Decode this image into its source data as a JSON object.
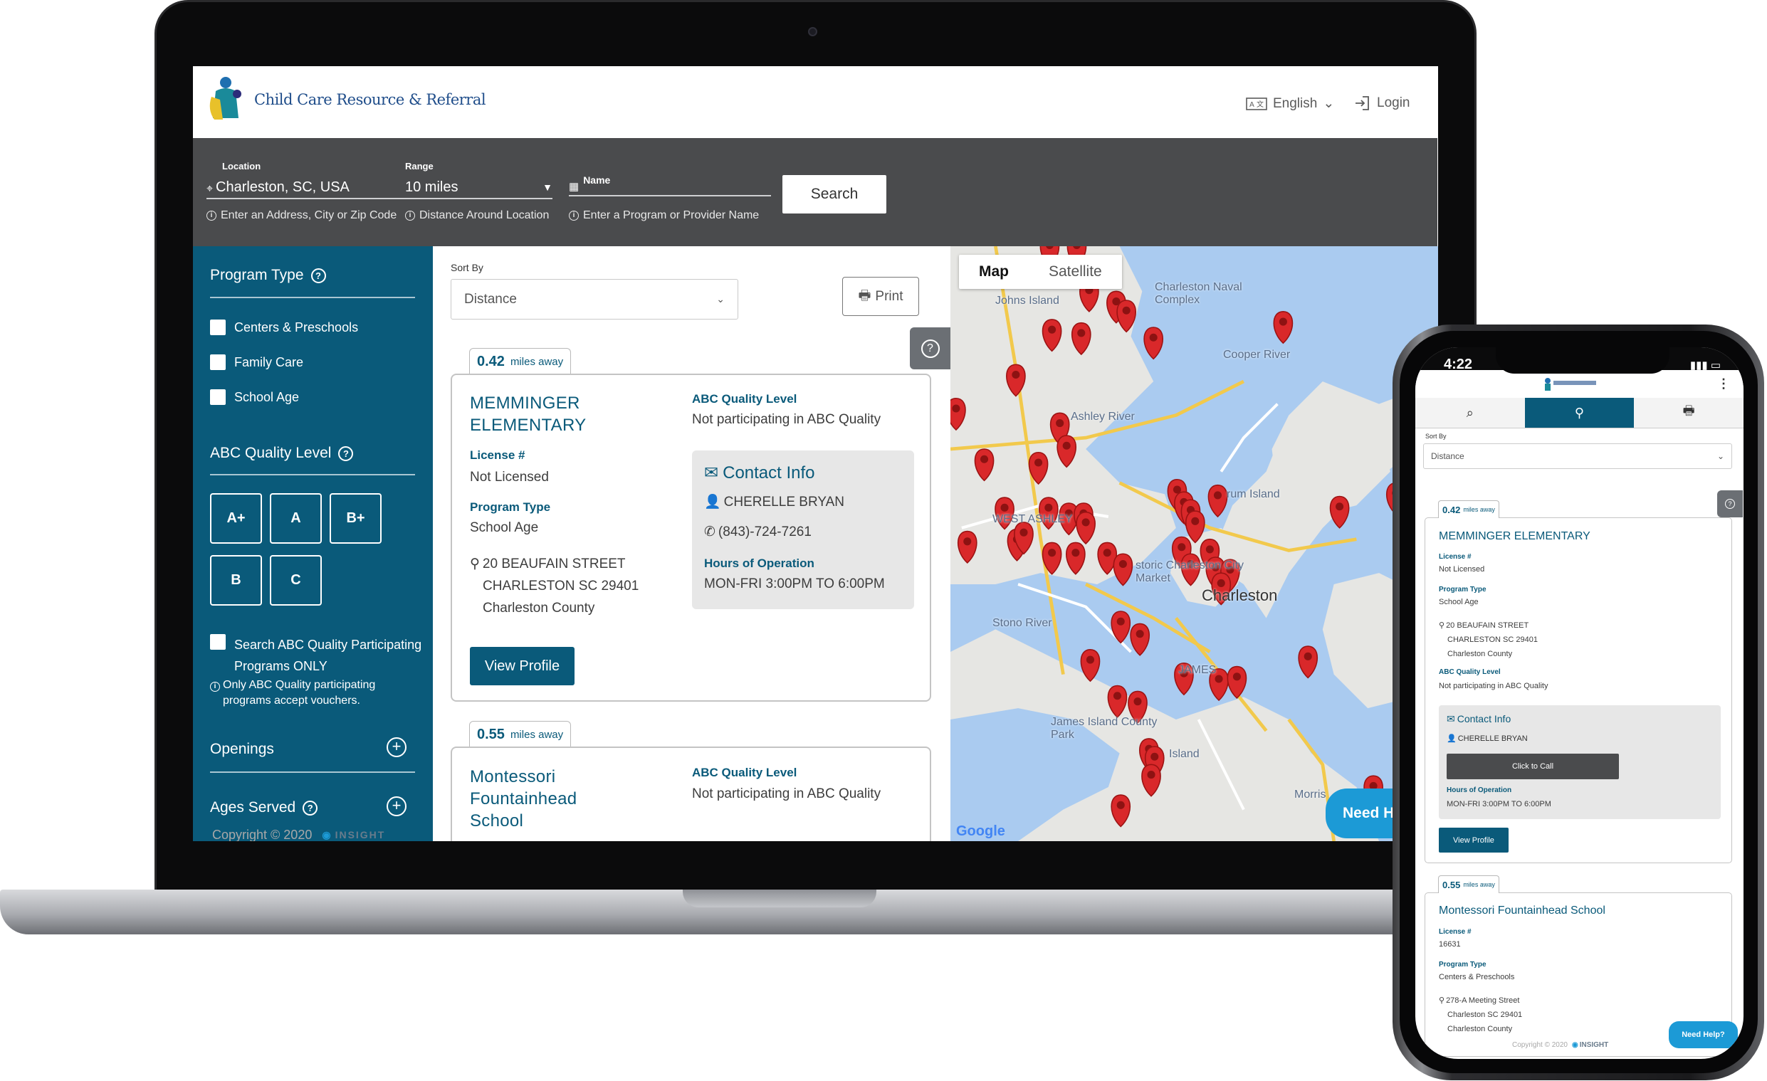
{
  "laptop": {
    "header": {
      "logo_text": "Child Care Resource & Referral",
      "language": "English",
      "login": "Login"
    },
    "search": {
      "location_label": "Location",
      "location_value": "Charleston, SC, USA",
      "location_hint": "Enter an Address, City or Zip Code",
      "range_label": "Range",
      "range_value": "10 miles",
      "range_hint": "Distance Around Location",
      "name_label": "Name",
      "name_hint": "Enter a Program or Provider Name",
      "search_button": "Search"
    },
    "sidebar": {
      "program_type_title": "Program Type",
      "program_types": [
        "Centers & Preschools",
        "Family Care",
        "School Age"
      ],
      "abc_title": "ABC Quality Level",
      "grades": [
        "A+",
        "A",
        "B+",
        "B",
        "C"
      ],
      "abc_only_line1": "Search ABC Quality Participating",
      "abc_only_line2": "Programs ONLY",
      "abc_note_line1": "Only ABC Quality participating",
      "abc_note_line2": "programs accept vouchers.",
      "openings": "Openings",
      "ages_served": "Ages Served"
    },
    "list": {
      "sort_label": "Sort By",
      "sort_value": "Distance",
      "print": "Print",
      "help": "?",
      "cards": [
        {
          "distance": "0.42",
          "distance_unit": "miles away",
          "name_line1": "MEMMINGER",
          "name_line2": "ELEMENTARY",
          "license_label": "License #",
          "license_value": "Not Licensed",
          "program_type_label": "Program Type",
          "program_type_value": "School Age",
          "address1": "20 BEAUFAIN STREET",
          "address2": "CHARLESTON  SC 29401",
          "address3": "Charleston County",
          "abc_label": "ABC Quality Level",
          "abc_value": "Not participating in ABC Quality",
          "contact_title": "Contact Info",
          "contact_name": "CHERELLE BRYAN",
          "contact_phone": "(843)-724-7261",
          "hours_label": "Hours of Operation",
          "hours_value": "MON-FRI 3:00PM TO 6:00PM",
          "view_profile": "View Profile"
        },
        {
          "distance": "0.55",
          "distance_unit": "miles away",
          "name_line1": "Montessori",
          "name_line2": "Fountainhead",
          "name_line3": "School",
          "abc_label": "ABC Quality Level",
          "abc_value": "Not participating in ABC Quality"
        }
      ]
    },
    "map": {
      "tab_map": "Map",
      "tab_satellite": "Satellite",
      "labels": [
        "Charleston Naval Complex",
        "Charleston",
        "rum Island",
        "James Island County Park",
        "Island",
        "Morris",
        "Johns Island",
        "storic Charleston City Market",
        "Stono River",
        "Ashley River",
        "Cooper River",
        "WEST ASHLEY",
        "JAMES"
      ],
      "google": "Google",
      "need_help": "Need He"
    },
    "footer": {
      "copyright": "Copyright © 2020",
      "brand": "INSIGHT"
    }
  },
  "phone": {
    "time": "4:22",
    "sort_label": "Sort By",
    "sort_value": "Distance",
    "help": "?",
    "cards": [
      {
        "distance": "0.42",
        "distance_unit": "miles away",
        "name": "MEMMINGER ELEMENTARY",
        "license_label": "License #",
        "license_value": "Not Licensed",
        "program_type_label": "Program Type",
        "program_type_value": "School Age",
        "address1": "20 BEAUFAIN STREET",
        "address2": "CHARLESTON  SC 29401",
        "address3": "Charleston County",
        "abc_label": "ABC Quality Level",
        "abc_value": "Not participating in ABC Quality",
        "contact_title": "Contact Info",
        "contact_name": "CHERELLE BRYAN",
        "call_button": "Click to Call",
        "hours_label": "Hours of Operation",
        "hours_value": "MON-FRI 3:00PM TO 6:00PM",
        "view_profile": "View Profile"
      },
      {
        "distance": "0.55",
        "distance_unit": "miles away",
        "name": "Montessori Fountainhead School",
        "license_label": "License #",
        "license_value": "16631",
        "program_type_label": "Program Type",
        "program_type_value": "Centers & Preschools",
        "address1": "278-A Meeting Street",
        "address2": "Charleston  SC 29401",
        "address3": "Charleston County"
      }
    ],
    "need_help": "Need Help?",
    "copyright": "Copyright © 2020",
    "brand": "INSIGHT"
  },
  "colors": {
    "brand": "#0a5a7a",
    "header_band": "#4a4b4d",
    "pin": "#d9282a",
    "water": "#aacbf0",
    "help_blue": "#1c9ad6"
  }
}
